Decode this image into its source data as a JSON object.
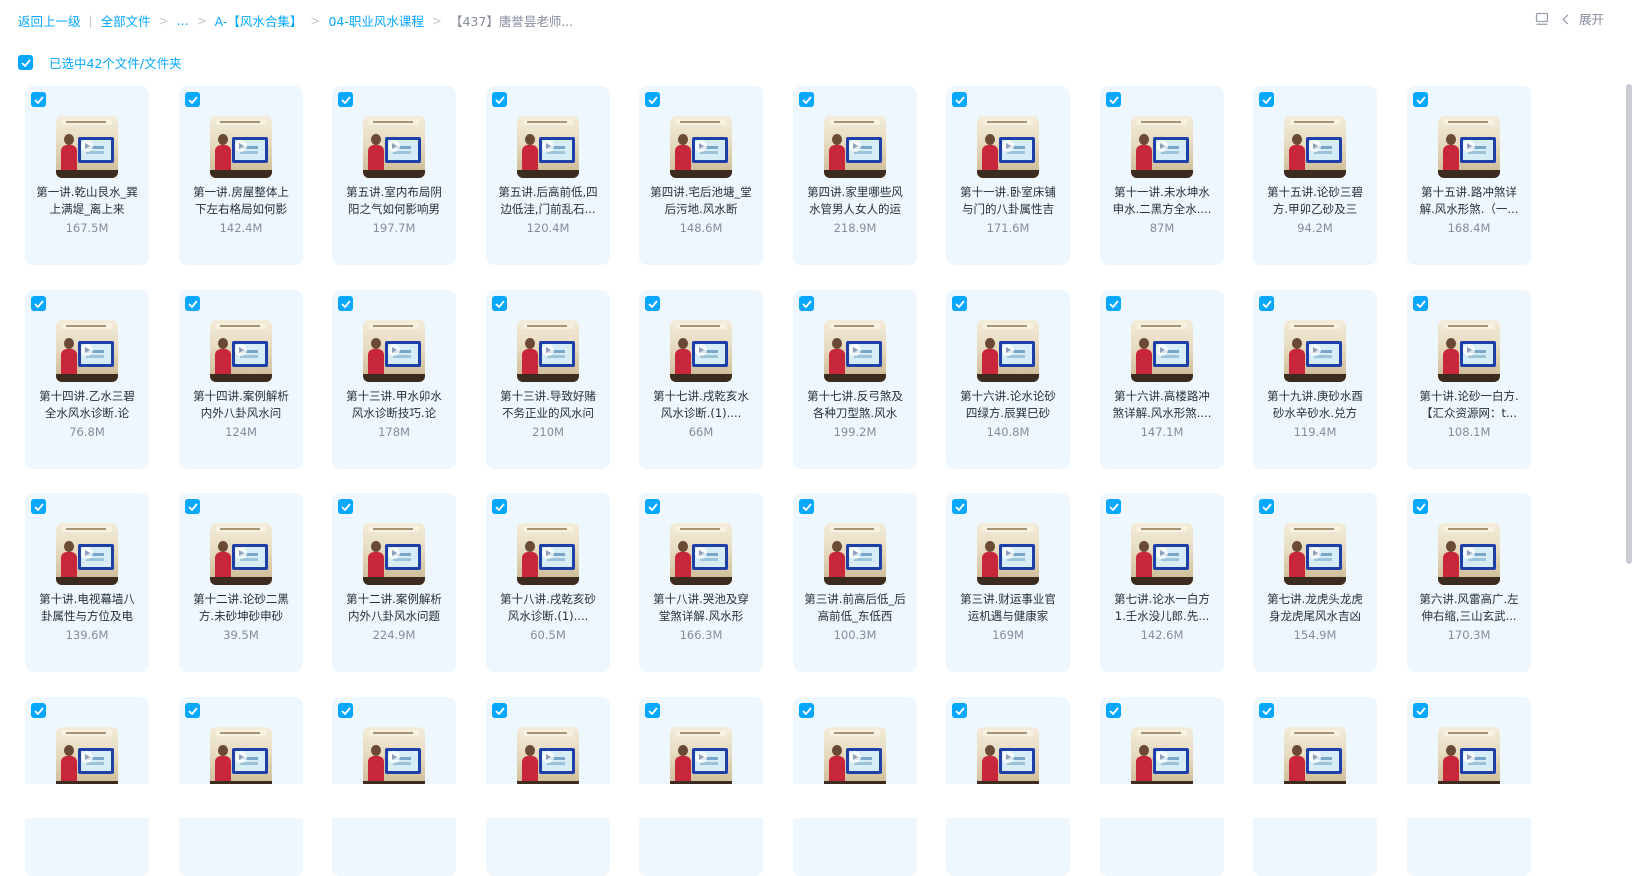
{
  "breadcrumb": {
    "back": "返回上一级",
    "all_files": "全部文件",
    "ellipsis": "...",
    "level1": "A-【风水合集】",
    "level2": "04-职业风水课程",
    "current": "【437】唐誉昙老师..."
  },
  "header_right": {
    "view_icon": "list-view-icon",
    "expand_label": "展开"
  },
  "selection": {
    "label": "已选中42个文件/文件夹",
    "checked": true
  },
  "colors": {
    "accent": "#06a7ff",
    "card_bg": "#eef7fe"
  },
  "files": [
    {
      "name": "第一讲.乾山艮水_巽上满堤_离上来",
      "size": "167.5M"
    },
    {
      "name": "第一讲.房屋整体上下左右格局如何影",
      "size": "142.4M"
    },
    {
      "name": "第五讲.室内布局阴阳之气如何影响男",
      "size": "197.7M"
    },
    {
      "name": "第五讲.后高前低,四边低洼,门前乱石...",
      "size": "120.4M"
    },
    {
      "name": "第四讲.宅后池塘_堂后污地.风水断",
      "size": "148.6M"
    },
    {
      "name": "第四讲.家里哪些风水管男人女人的运",
      "size": "218.9M"
    },
    {
      "name": "第十一讲.卧室床铺与门的八卦属性吉",
      "size": "171.6M"
    },
    {
      "name": "第十一讲.未水坤水申水.二黑方全水....",
      "size": "87M"
    },
    {
      "name": "第十五讲.论砂三碧方.甲卯乙砂及三",
      "size": "94.2M"
    },
    {
      "name": "第十五讲.路冲煞详解.风水形煞.（一...",
      "size": "168.4M"
    },
    {
      "name": "第十四讲.乙水三碧全水风水诊断.论",
      "size": "76.8M"
    },
    {
      "name": "第十四讲.案例解析内外八卦风水问",
      "size": "124M"
    },
    {
      "name": "第十三讲.甲水卯水风水诊断技巧.论",
      "size": "178M"
    },
    {
      "name": "第十三讲.导致好赌不务正业的风水问",
      "size": "210M"
    },
    {
      "name": "第十七讲.戌乾亥水风水诊断.(1)....",
      "size": "66M"
    },
    {
      "name": "第十七讲.反弓煞及各种刀型煞.风水",
      "size": "199.2M"
    },
    {
      "name": "第十六讲.论水论砂四绿方.辰巽巳砂",
      "size": "140.8M"
    },
    {
      "name": "第十六讲.高楼路冲煞详解.风水形煞....",
      "size": "147.1M"
    },
    {
      "name": "第十九讲.庚砂水酉砂水辛砂水.兑方",
      "size": "119.4M"
    },
    {
      "name": "第十讲.论砂一白方.【汇众资源网：t...",
      "size": "108.1M"
    },
    {
      "name": "第十讲.电视幕墙八卦属性与方位及电",
      "size": "139.6M"
    },
    {
      "name": "第十二讲.论砂二黑方.未砂坤砂申砂",
      "size": "39.5M"
    },
    {
      "name": "第十二讲.案例解析内外八卦风水问题",
      "size": "224.9M"
    },
    {
      "name": "第十八讲.戌乾亥砂风水诊断.(1)....",
      "size": "60.5M"
    },
    {
      "name": "第十八讲.哭池及穿堂煞详解.风水形",
      "size": "166.3M"
    },
    {
      "name": "第三讲.前高后低_后高前低_东低西",
      "size": "100.3M"
    },
    {
      "name": "第三讲.财运事业官运机遇与健康家",
      "size": "169M"
    },
    {
      "name": "第七讲.论水一白方1.壬水没儿郎.先...",
      "size": "142.6M"
    },
    {
      "name": "第七讲.龙虎头龙虎身龙虎尾风水吉凶",
      "size": "154.9M"
    },
    {
      "name": "第六讲.风雷高广.左伸右缩,三山玄武...",
      "size": "170.3M"
    },
    {
      "name": "",
      "size": ""
    },
    {
      "name": "",
      "size": ""
    },
    {
      "name": "",
      "size": ""
    },
    {
      "name": "",
      "size": ""
    },
    {
      "name": "",
      "size": ""
    },
    {
      "name": "",
      "size": ""
    },
    {
      "name": "",
      "size": ""
    },
    {
      "name": "",
      "size": ""
    },
    {
      "name": "",
      "size": ""
    },
    {
      "name": "",
      "size": ""
    }
  ]
}
